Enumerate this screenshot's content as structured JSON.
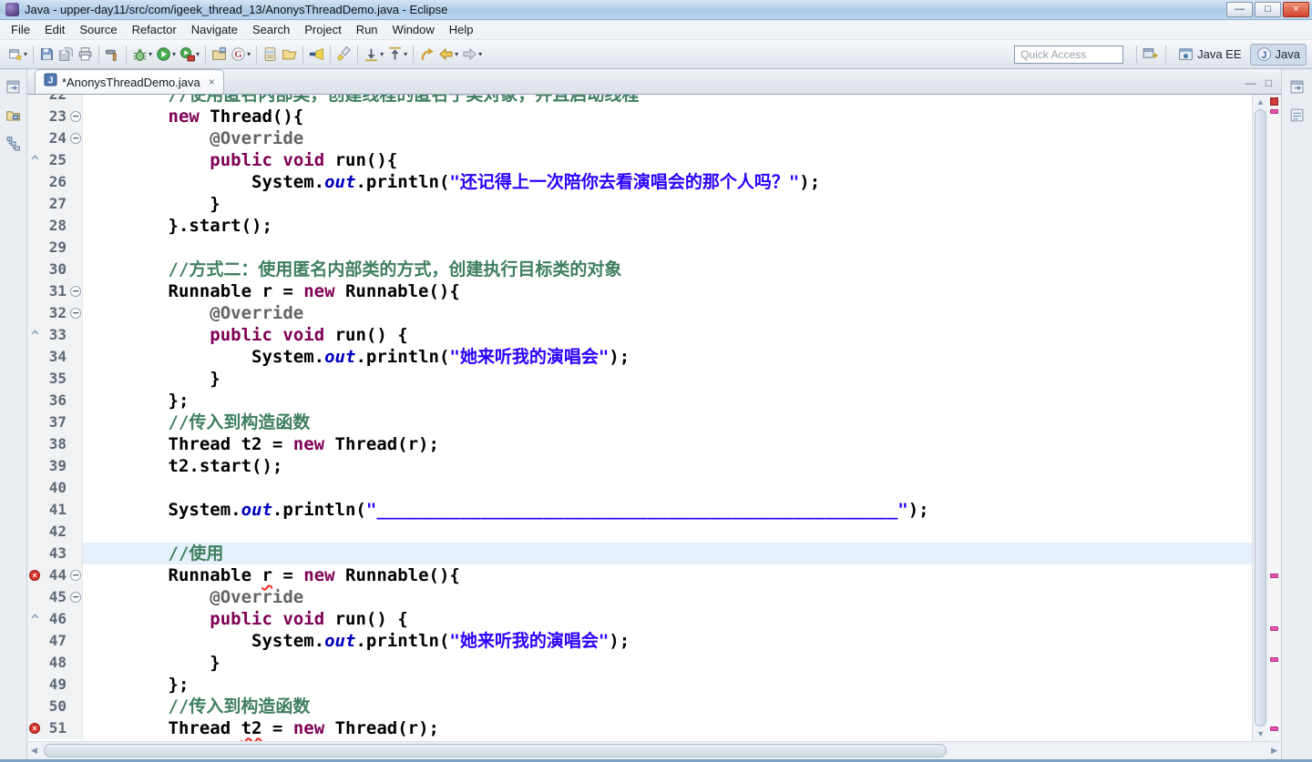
{
  "window": {
    "title": "Java - upper-day11/src/com/igeek_thread_13/AnonysThreadDemo.java - Eclipse",
    "controls": {
      "minimize": "—",
      "maximize": "□",
      "close": "×"
    }
  },
  "menu": {
    "items": [
      "File",
      "Edit",
      "Source",
      "Refactor",
      "Navigate",
      "Search",
      "Project",
      "Run",
      "Window",
      "Help"
    ]
  },
  "toolbar": {
    "quick_access_label": "Quick Access",
    "icons": [
      {
        "name": "new-wizard-icon",
        "type": "new",
        "dropdown": true
      },
      {
        "name": "save-icon",
        "type": "save",
        "sepBefore": true
      },
      {
        "name": "save-all-icon",
        "type": "saveall"
      },
      {
        "name": "print-icon",
        "type": "print"
      },
      {
        "name": "build-icon",
        "type": "tool",
        "sepBefore": true
      },
      {
        "name": "debug-icon",
        "type": "debug",
        "dropdown": true,
        "sepBefore": true
      },
      {
        "name": "run-icon",
        "type": "run",
        "dropdown": true
      },
      {
        "name": "run-external-tools-icon",
        "type": "runx",
        "dropdown": true
      },
      {
        "name": "new-java-project-icon",
        "type": "newprj",
        "sepBefore": true
      },
      {
        "name": "generate-icon",
        "type": "g",
        "dropdown": true
      },
      {
        "name": "new-jar-icon",
        "type": "jar",
        "sepBefore": true
      },
      {
        "name": "open-folder-icon",
        "type": "folder"
      },
      {
        "name": "search-icon",
        "type": "search",
        "sepBefore": true
      },
      {
        "name": "mark-occurrences-icon",
        "type": "mark",
        "sepBefore": true
      },
      {
        "name": "next-annotation-icon",
        "type": "nexta",
        "dropdown": true,
        "sepBefore": true
      },
      {
        "name": "previous-annotation-icon",
        "type": "preva",
        "dropdown": true
      },
      {
        "name": "last-edit-location-icon",
        "type": "lastedit",
        "sepBefore": true
      },
      {
        "name": "back-icon",
        "type": "back",
        "dropdown": true
      },
      {
        "name": "forward-icon",
        "type": "fwd",
        "dropdown": true
      }
    ],
    "perspectives": [
      {
        "name": "java-ee",
        "label": "Java EE",
        "active": false
      },
      {
        "name": "java",
        "label": "Java",
        "active": true
      }
    ]
  },
  "left_rail": {
    "icons": [
      "restore-views-icon",
      "package-explorer-icon",
      "type-hierarchy-icon"
    ]
  },
  "right_rail": {
    "icons": [
      "restore-views-icon",
      "task-list-icon"
    ]
  },
  "editor": {
    "tab": {
      "title": "*AnonysThreadDemo.java",
      "close_glyph": "×"
    },
    "minimize_glyph": "—",
    "maximize_glyph": "□",
    "overview": {
      "status_color": "#cf3a3a",
      "marker_color": "#ea52b2",
      "marker_tops": [
        16,
        526,
        584,
        618,
        694
      ]
    },
    "lines": [
      {
        "n": 22,
        "seg": [
          [
            "        //使用匿名内部类，创建线程的匿名子类对象，并且启动线程",
            "c"
          ]
        ]
      },
      {
        "n": 23,
        "fold": true,
        "seg": [
          [
            "        ",
            "p"
          ],
          [
            "new",
            "k"
          ],
          [
            " Thread(){",
            "p"
          ]
        ]
      },
      {
        "n": 24,
        "fold": true,
        "seg": [
          [
            "            ",
            "p"
          ],
          [
            "@Override",
            "a"
          ]
        ]
      },
      {
        "n": 25,
        "mk": "caret",
        "seg": [
          [
            "            ",
            "p"
          ],
          [
            "public",
            "k"
          ],
          [
            " ",
            "p"
          ],
          [
            "void",
            "k"
          ],
          [
            " run(){",
            "p"
          ]
        ]
      },
      {
        "n": 26,
        "seg": [
          [
            "                ",
            "p"
          ],
          [
            "System.",
            "p"
          ],
          [
            "out",
            "f"
          ],
          [
            ".println(",
            "p"
          ],
          [
            "\"还记得上一次陪你去看演唱会的那个人吗？\"",
            "s"
          ],
          [
            ");",
            "p"
          ]
        ]
      },
      {
        "n": 27,
        "seg": [
          [
            "            }",
            "p"
          ]
        ]
      },
      {
        "n": 28,
        "seg": [
          [
            "        }.start();",
            "p"
          ]
        ]
      },
      {
        "n": 29,
        "seg": []
      },
      {
        "n": 30,
        "seg": [
          [
            "        //方式二：使用匿名内部类的方式，创建执行目标类的对象",
            "c"
          ]
        ]
      },
      {
        "n": 31,
        "fold": true,
        "seg": [
          [
            "        Runnable r = ",
            "p"
          ],
          [
            "new",
            "k"
          ],
          [
            " Runnable(){",
            "p"
          ]
        ]
      },
      {
        "n": 32,
        "fold": true,
        "seg": [
          [
            "            ",
            "p"
          ],
          [
            "@Override",
            "a"
          ]
        ]
      },
      {
        "n": 33,
        "mk": "caret",
        "seg": [
          [
            "            ",
            "p"
          ],
          [
            "public",
            "k"
          ],
          [
            " ",
            "p"
          ],
          [
            "void",
            "k"
          ],
          [
            " run() {",
            "p"
          ]
        ]
      },
      {
        "n": 34,
        "seg": [
          [
            "                ",
            "p"
          ],
          [
            "System.",
            "p"
          ],
          [
            "out",
            "f"
          ],
          [
            ".println(",
            "p"
          ],
          [
            "\"她来听我的演唱会\"",
            "s"
          ],
          [
            ");",
            "p"
          ]
        ]
      },
      {
        "n": 35,
        "seg": [
          [
            "            }",
            "p"
          ]
        ]
      },
      {
        "n": 36,
        "seg": [
          [
            "        };",
            "p"
          ]
        ]
      },
      {
        "n": 37,
        "seg": [
          [
            "        //传入到构造函数",
            "c"
          ]
        ]
      },
      {
        "n": 38,
        "seg": [
          [
            "        Thread t2 = ",
            "p"
          ],
          [
            "new",
            "k"
          ],
          [
            " Thread(r);",
            "p"
          ]
        ]
      },
      {
        "n": 39,
        "seg": [
          [
            "        t2.start();",
            "p"
          ]
        ]
      },
      {
        "n": 40,
        "seg": []
      },
      {
        "n": 41,
        "seg": [
          [
            "        System.",
            "p"
          ],
          [
            "out",
            "f"
          ],
          [
            ".println(",
            "p"
          ],
          [
            "\"__________________________________________________\"",
            "s"
          ],
          [
            ");",
            "p"
          ]
        ]
      },
      {
        "n": 42,
        "seg": []
      },
      {
        "n": 43,
        "hl": true,
        "seg": [
          [
            "        //使用",
            "c"
          ]
        ]
      },
      {
        "n": 44,
        "fold": true,
        "mk": "err",
        "seg": [
          [
            "        Runnable ",
            "p"
          ],
          [
            "r",
            "e"
          ],
          [
            " = ",
            "p"
          ],
          [
            "new",
            "k"
          ],
          [
            " Runnable(){",
            "p"
          ]
        ]
      },
      {
        "n": 45,
        "fold": true,
        "seg": [
          [
            "            ",
            "p"
          ],
          [
            "@Override",
            "a"
          ]
        ]
      },
      {
        "n": 46,
        "mk": "caret",
        "seg": [
          [
            "            ",
            "p"
          ],
          [
            "public",
            "k"
          ],
          [
            " ",
            "p"
          ],
          [
            "void",
            "k"
          ],
          [
            " run() {",
            "p"
          ]
        ]
      },
      {
        "n": 47,
        "seg": [
          [
            "                ",
            "p"
          ],
          [
            "System.",
            "p"
          ],
          [
            "out",
            "f"
          ],
          [
            ".println(",
            "p"
          ],
          [
            "\"她来听我的演唱会\"",
            "s"
          ],
          [
            ");",
            "p"
          ]
        ]
      },
      {
        "n": 48,
        "seg": [
          [
            "            }",
            "p"
          ]
        ]
      },
      {
        "n": 49,
        "seg": [
          [
            "        };",
            "p"
          ]
        ]
      },
      {
        "n": 50,
        "seg": [
          [
            "        //传入到构造函数",
            "c"
          ]
        ]
      },
      {
        "n": 51,
        "mk": "err",
        "seg": [
          [
            "        Thread ",
            "p"
          ],
          [
            "t2",
            "e"
          ],
          [
            " = ",
            "p"
          ],
          [
            "new",
            "k"
          ],
          [
            " Thread(r);",
            "p"
          ]
        ]
      }
    ]
  }
}
